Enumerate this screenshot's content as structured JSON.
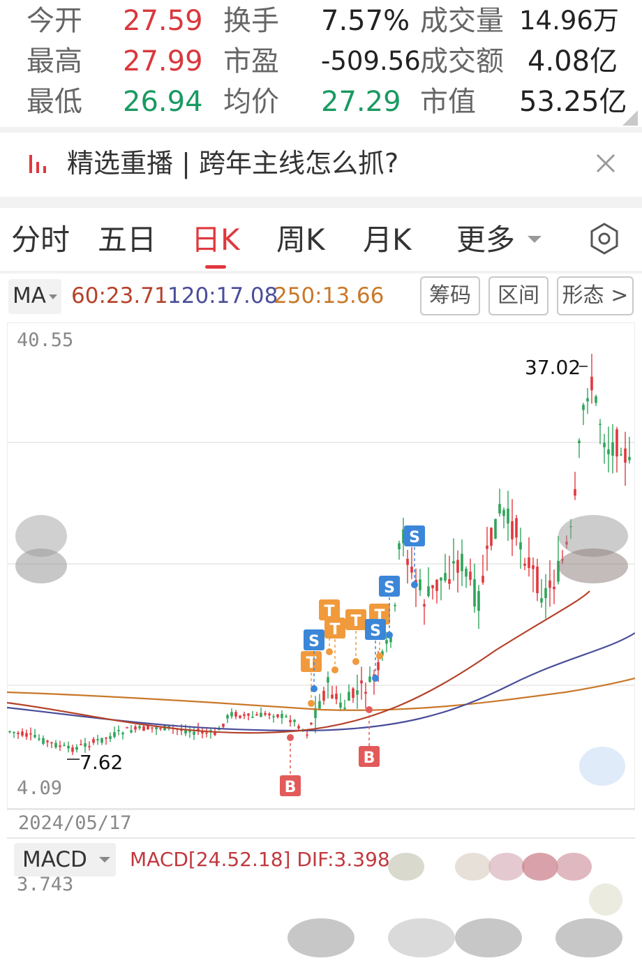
{
  "quote": {
    "open_label": "今开",
    "open_value": "27.59",
    "high_label": "最高",
    "high_value": "27.99",
    "low_label": "最低",
    "low_value": "26.94",
    "turnover_label": "换手",
    "turnover_value": "7.57%",
    "pe_label": "市盈",
    "pe_value": "-509.56",
    "avg_label": "均价",
    "avg_value": "27.29",
    "volume_label": "成交量",
    "volume_value": "14.96万",
    "amount_label": "成交额",
    "amount_value": "4.08亿",
    "mcap_label": "市值",
    "mcap_value": "53.25亿",
    "colors": {
      "up": "#d9383e",
      "down": "#1a9a62",
      "neutral": "#222222"
    }
  },
  "banner": {
    "text": "精选重播 | 跨年主线怎么抓?"
  },
  "tabs": [
    {
      "label": "分时"
    },
    {
      "label": "五日"
    },
    {
      "label": "日K",
      "active": true
    },
    {
      "label": "周K"
    },
    {
      "label": "月K"
    },
    {
      "label": "更多"
    }
  ],
  "ma_bar": {
    "selector": "MA",
    "ma60": "60:23.71",
    "ma120": "120:17.08",
    "ma250": "250:13.66",
    "colors": {
      "ma60": "#b5422a",
      "ma120": "#4a4d9a",
      "ma250": "#c9782a"
    }
  },
  "tools": [
    {
      "label": "筹码"
    },
    {
      "label": "区间"
    },
    {
      "label": "形态 >"
    }
  ],
  "chart": {
    "y_max_label": "40.55",
    "y_min_label": "4.09",
    "high_marker": "37.02",
    "low_marker": "7.62",
    "date_label": "2024/05/17",
    "signal_b": "B",
    "signal_s": "S",
    "signal_t": "T",
    "colors": {
      "up": "#e0383e",
      "down": "#2fa55a",
      "b": "#e35a5a",
      "s": "#3b86d8",
      "t": "#f09a3c"
    }
  },
  "macd": {
    "selector": "MACD",
    "params": "MACD[24.52.18] DIF:3.398",
    "value": "3.743"
  }
}
